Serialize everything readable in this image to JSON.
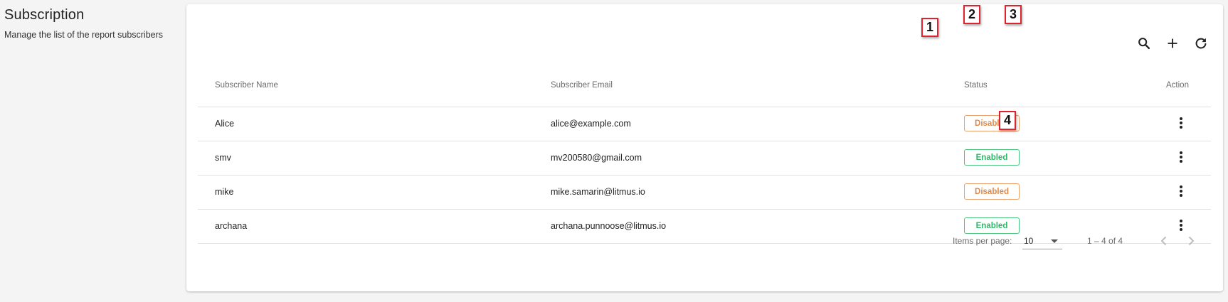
{
  "header": {
    "title": "Subscription",
    "subtitle": "Manage the list of the report subscribers"
  },
  "toolbar": {
    "search_icon": "search-icon",
    "add_icon": "plus-icon",
    "refresh_icon": "refresh-icon"
  },
  "markers": [
    "1",
    "2",
    "3",
    "4"
  ],
  "table": {
    "columns": [
      "Subscriber Name",
      "Subscriber Email",
      "Status",
      "Action"
    ],
    "rows": [
      {
        "name": "Alice",
        "email": "alice@example.com",
        "status": "Disabled"
      },
      {
        "name": "smv",
        "email": "mv200580@gmail.com",
        "status": "Enabled"
      },
      {
        "name": "mike",
        "email": "mike.samarin@litmus.io",
        "status": "Disabled"
      },
      {
        "name": "archana",
        "email": "archana.punnoose@litmus.io",
        "status": "Enabled"
      }
    ]
  },
  "paginator": {
    "items_per_page_label": "Items per page:",
    "page_size": "10",
    "range_label": "1 – 4 of 4"
  },
  "colors": {
    "disabled": "#e08a4b",
    "enabled": "#2fb86b",
    "marker_border": "#e0242d"
  }
}
